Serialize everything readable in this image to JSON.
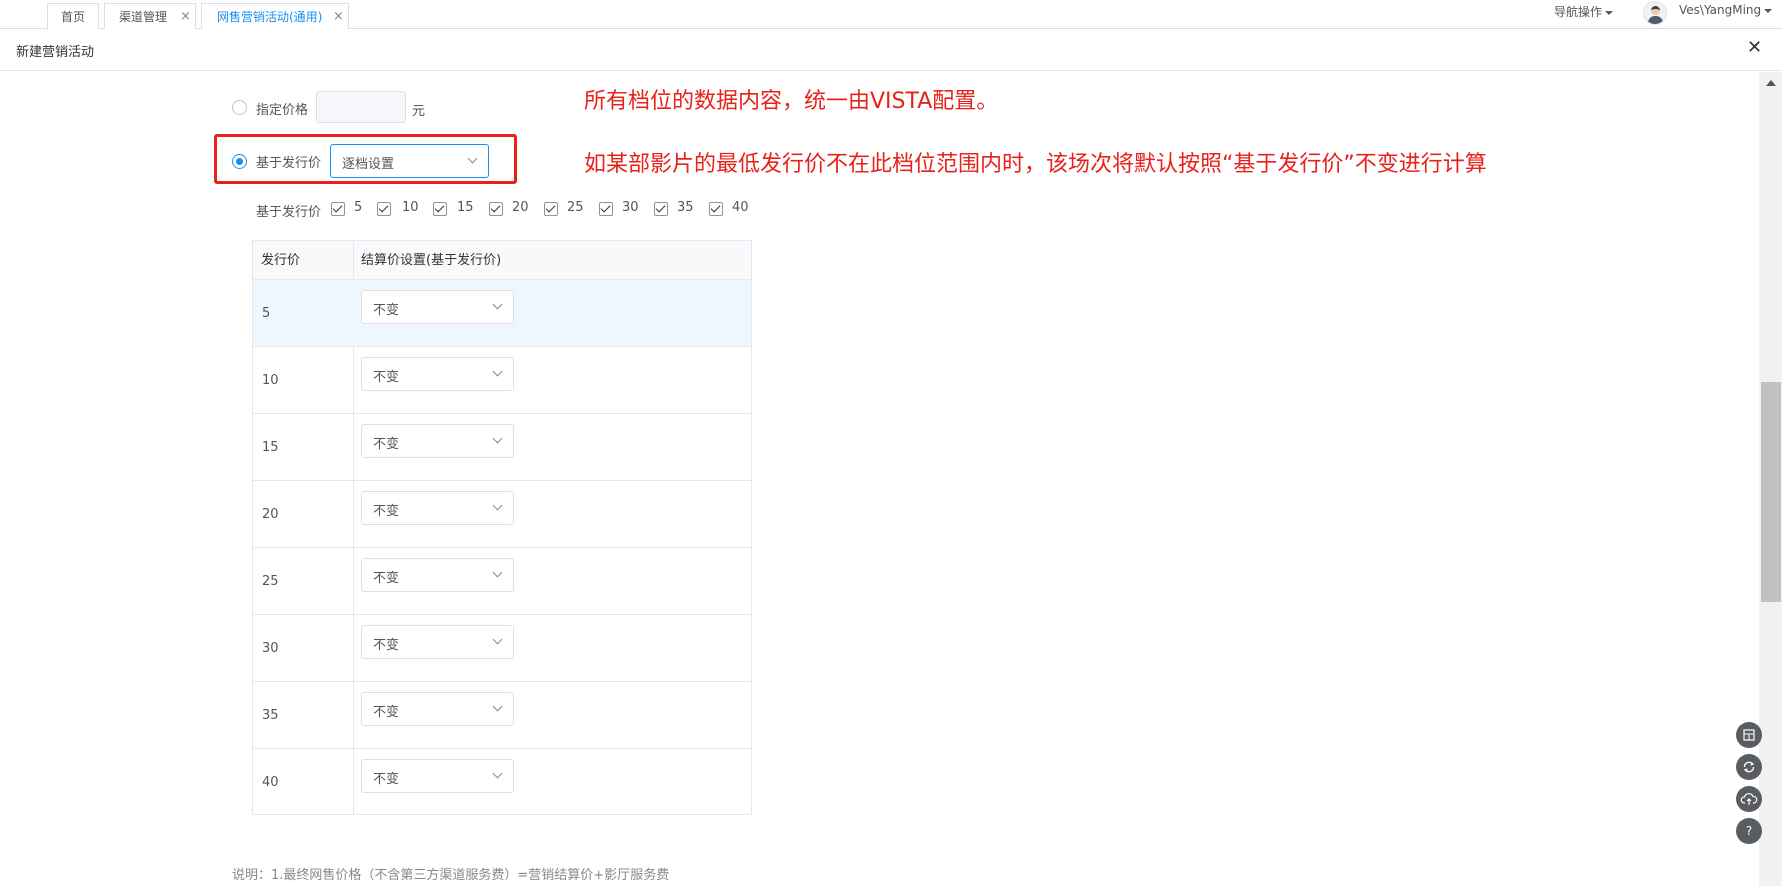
{
  "tabs": [
    {
      "label": "首页",
      "closable": false
    },
    {
      "label": "渠道管理",
      "closable": true
    },
    {
      "label": "网售营销活动(通用)",
      "closable": true,
      "active": true
    }
  ],
  "tab_close_glyph": "×",
  "header": {
    "nav_ops": "导航操作",
    "username": "Ves\\YangMing"
  },
  "dialog": {
    "title": "新建营销活动",
    "close_glyph": "✕"
  },
  "form": {
    "fixed_price_label": "指定价格",
    "fixed_price_value": "",
    "currency_unit": "元",
    "base_issue_label": "基于发行价",
    "base_issue_select": "逐档设置",
    "tiers_label": "基于发行价",
    "tiers": [
      "5",
      "10",
      "15",
      "20",
      "25",
      "30",
      "35",
      "40"
    ]
  },
  "annotations": {
    "note1": "所有档位的数据内容，统一由VISTA配置。",
    "note2": "如某部影片的最低发行价不在此档位范围内时，该场次将默认按照“基于发行价”不变进行计算"
  },
  "table": {
    "columns": [
      "发行价",
      "结算价设置(基于发行价)"
    ],
    "rows": [
      {
        "price": "5",
        "setting": "不变"
      },
      {
        "price": "10",
        "setting": "不变"
      },
      {
        "price": "15",
        "setting": "不变"
      },
      {
        "price": "20",
        "setting": "不变"
      },
      {
        "price": "25",
        "setting": "不变"
      },
      {
        "price": "30",
        "setting": "不变"
      },
      {
        "price": "35",
        "setting": "不变"
      },
      {
        "price": "40",
        "setting": "不变"
      }
    ]
  },
  "footnote": "说明：1.最终网售价格（不含第三方渠道服务费）=营销结算价+影厅服务费",
  "floating_buttons": [
    "calculator-icon",
    "refresh-icon",
    "cloud-upload-icon",
    "help-icon"
  ],
  "help_glyph": "?",
  "colors": {
    "accent": "#1a8ff0",
    "annotation": "#e8211b"
  }
}
